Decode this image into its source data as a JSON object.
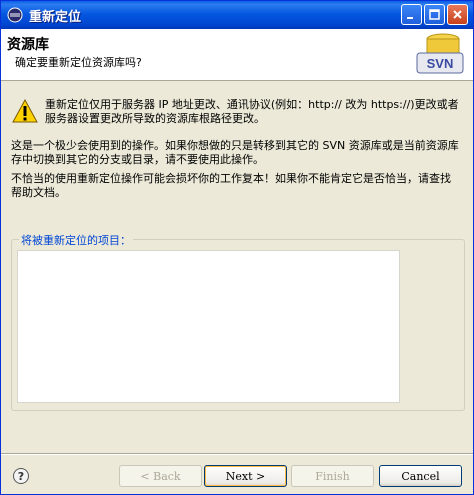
{
  "window": {
    "title": "重新定位"
  },
  "header": {
    "title": "资源库",
    "subtitle": "确定要重新定位资源库吗?",
    "logo_text": "SVN"
  },
  "messages": {
    "warning": "重新定位仅用于服务器 IP 地址更改、通讯协议(例如：http:// 改为 https://)更改或者服务器设置更改所导致的资源库根路径更改。",
    "rare_op": "这是一个极少会使用到的操作。如果你想做的只是转移到其它的 SVN 资源库或是当前资源库存中切换到其它的分支或目录，请不要使用此操作。",
    "danger": "不恰当的使用重新定位操作可能会损坏你的工作复本！如果你不能肯定它是否恰当，请查找帮助文档。"
  },
  "group": {
    "label": "将被重新定位的项目："
  },
  "footer": {
    "help_label": "?",
    "back_label": "< Back",
    "next_label": "Next >",
    "finish_label": "Finish",
    "cancel_label": "Cancel"
  },
  "colors": {
    "title_bar": "#0558e0",
    "group_label": "#0046d5",
    "dialog_bg": "#ece9d8"
  }
}
